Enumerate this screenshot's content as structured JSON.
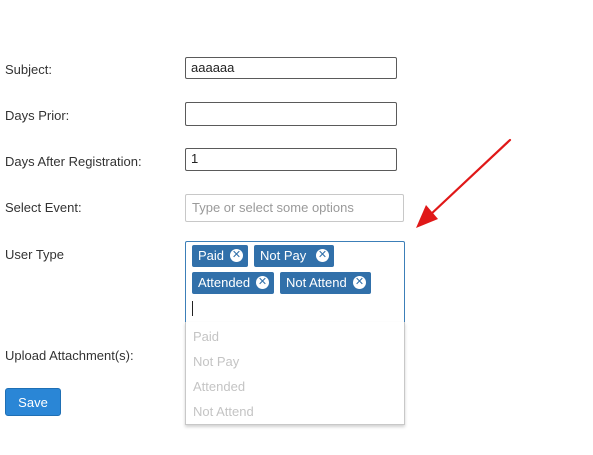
{
  "form": {
    "subject": {
      "label": "Subject:",
      "value": "aaaaaa"
    },
    "days_prior": {
      "label": "Days Prior:",
      "value": ""
    },
    "days_after": {
      "label": "Days After Registration:",
      "value": "1"
    },
    "select_event": {
      "label": "Select Event:",
      "placeholder": "Type or select some options"
    },
    "user_type": {
      "label": "User Type",
      "selected": [
        "Paid",
        "Not Pay",
        "Attended",
        "Not Attend"
      ],
      "options": [
        "Paid",
        "Not Pay",
        "Attended",
        "Not Attend"
      ]
    },
    "upload": {
      "label": "Upload Attachment(s):"
    },
    "save_label": "Save"
  },
  "colors": {
    "tag_bg": "#3170aa",
    "save_bg": "#2a86d6",
    "arrow": "#e01818"
  }
}
